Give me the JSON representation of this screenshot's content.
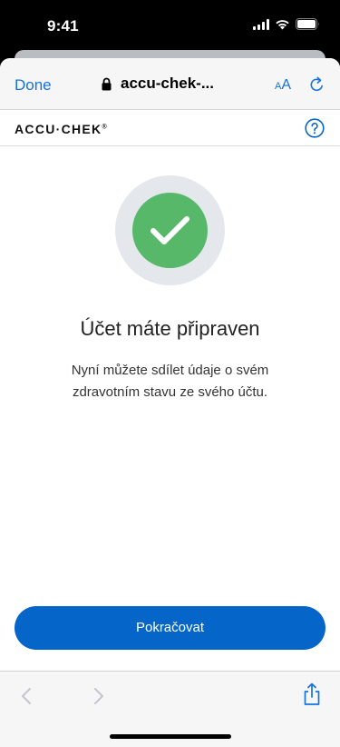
{
  "status_bar": {
    "time": "9:41"
  },
  "browser": {
    "done_label": "Done",
    "url": "accu-chek-...",
    "text_size_label_small": "A",
    "text_size_label_large": "A"
  },
  "site": {
    "logo_text": "ACCU·CHEK",
    "logo_mark": "®"
  },
  "content": {
    "title": "Účet máte připraven",
    "description": "Nyní můžete sdílet údaje o svém zdravotním stavu ze svého účtu."
  },
  "actions": {
    "continue_label": "Pokračovat"
  },
  "colors": {
    "accent": "#1672e0",
    "button": "#0565c8",
    "success": "#58b86a"
  }
}
